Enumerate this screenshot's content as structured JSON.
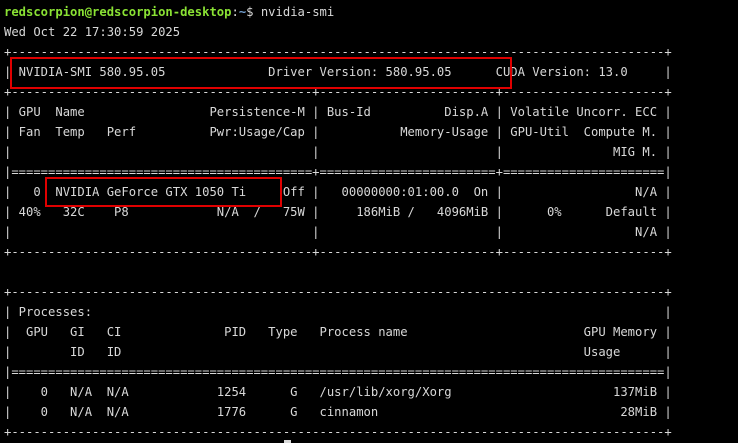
{
  "terminal": {
    "prompt": {
      "user_host": "redscorpion@redscorpion-desktop",
      "path": "~",
      "symbol": "$",
      "command": "nvidia-smi"
    },
    "lines": [
      "Wed Oct 22 17:30:59 2025",
      "+-----------------------------------------------------------------------------------------+",
      "| NVIDIA-SMI 580.95.05              Driver Version: 580.95.05      CUDA Version: 13.0     |",
      "+-----------------------------------------+------------------------+----------------------+",
      "| GPU  Name                 Persistence-M | Bus-Id          Disp.A | Volatile Uncorr. ECC |",
      "| Fan  Temp   Perf          Pwr:Usage/Cap |           Memory-Usage | GPU-Util  Compute M. |",
      "|                                         |                        |               MIG M. |",
      "|=========================================+========================+======================|",
      "|   0  NVIDIA GeForce GTX 1050 Ti     Off |   00000000:01:00.0  On |                  N/A |",
      "| 40%   32C    P8            N/A  /   75W |     186MiB /   4096MiB |      0%      Default |",
      "|                                         |                        |                  N/A |",
      "+-----------------------------------------+------------------------+----------------------+",
      "",
      "+-----------------------------------------------------------------------------------------+",
      "| Processes:                                                                              |",
      "|  GPU   GI   CI              PID   Type   Process name                        GPU Memory |",
      "|        ID   ID                                                               Usage      |",
      "|=========================================================================================|",
      "|    0   N/A  N/A            1254      G   /usr/lib/xorg/Xorg                      137MiB |",
      "|    0   N/A  N/A            1776      G   cinnamon                                 28MiB |",
      "+-----------------------------------------------------------------------------------------+"
    ]
  },
  "colors": {
    "background": "#000000",
    "foreground": "#d8d8d8",
    "prompt_user": "#8ae234",
    "prompt_path": "#729fcf",
    "highlight": "#e00000"
  }
}
